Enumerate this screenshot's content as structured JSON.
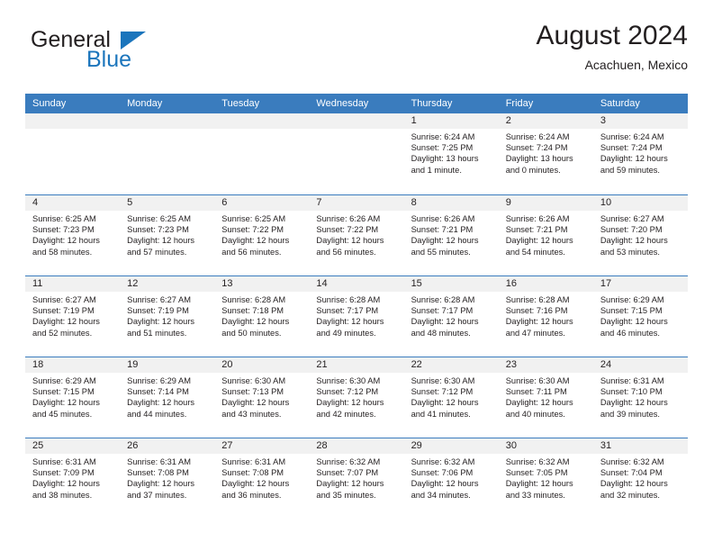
{
  "brand": {
    "name_top": "General",
    "name_bottom": "Blue",
    "accent_color": "#1b75bc"
  },
  "header": {
    "title": "August 2024",
    "subtitle": "Acachuen, Mexico"
  },
  "colors": {
    "header_row": "#3a7cbe",
    "day_band": "#f1f1f1",
    "text": "#231f20",
    "brand_blue": "#1b75bc"
  },
  "weekdays": [
    "Sunday",
    "Monday",
    "Tuesday",
    "Wednesday",
    "Thursday",
    "Friday",
    "Saturday"
  ],
  "weeks": [
    [
      {
        "day": "",
        "empty": true,
        "sunrise": "",
        "sunset": "",
        "daylight1": "",
        "daylight2": ""
      },
      {
        "day": "",
        "empty": true,
        "sunrise": "",
        "sunset": "",
        "daylight1": "",
        "daylight2": ""
      },
      {
        "day": "",
        "empty": true,
        "sunrise": "",
        "sunset": "",
        "daylight1": "",
        "daylight2": ""
      },
      {
        "day": "",
        "empty": true,
        "sunrise": "",
        "sunset": "",
        "daylight1": "",
        "daylight2": ""
      },
      {
        "day": "1",
        "empty": false,
        "sunrise": "Sunrise: 6:24 AM",
        "sunset": "Sunset: 7:25 PM",
        "daylight1": "Daylight: 13 hours",
        "daylight2": "and 1 minute."
      },
      {
        "day": "2",
        "empty": false,
        "sunrise": "Sunrise: 6:24 AM",
        "sunset": "Sunset: 7:24 PM",
        "daylight1": "Daylight: 13 hours",
        "daylight2": "and 0 minutes."
      },
      {
        "day": "3",
        "empty": false,
        "sunrise": "Sunrise: 6:24 AM",
        "sunset": "Sunset: 7:24 PM",
        "daylight1": "Daylight: 12 hours",
        "daylight2": "and 59 minutes."
      }
    ],
    [
      {
        "day": "4",
        "empty": false,
        "sunrise": "Sunrise: 6:25 AM",
        "sunset": "Sunset: 7:23 PM",
        "daylight1": "Daylight: 12 hours",
        "daylight2": "and 58 minutes."
      },
      {
        "day": "5",
        "empty": false,
        "sunrise": "Sunrise: 6:25 AM",
        "sunset": "Sunset: 7:23 PM",
        "daylight1": "Daylight: 12 hours",
        "daylight2": "and 57 minutes."
      },
      {
        "day": "6",
        "empty": false,
        "sunrise": "Sunrise: 6:25 AM",
        "sunset": "Sunset: 7:22 PM",
        "daylight1": "Daylight: 12 hours",
        "daylight2": "and 56 minutes."
      },
      {
        "day": "7",
        "empty": false,
        "sunrise": "Sunrise: 6:26 AM",
        "sunset": "Sunset: 7:22 PM",
        "daylight1": "Daylight: 12 hours",
        "daylight2": "and 56 minutes."
      },
      {
        "day": "8",
        "empty": false,
        "sunrise": "Sunrise: 6:26 AM",
        "sunset": "Sunset: 7:21 PM",
        "daylight1": "Daylight: 12 hours",
        "daylight2": "and 55 minutes."
      },
      {
        "day": "9",
        "empty": false,
        "sunrise": "Sunrise: 6:26 AM",
        "sunset": "Sunset: 7:21 PM",
        "daylight1": "Daylight: 12 hours",
        "daylight2": "and 54 minutes."
      },
      {
        "day": "10",
        "empty": false,
        "sunrise": "Sunrise: 6:27 AM",
        "sunset": "Sunset: 7:20 PM",
        "daylight1": "Daylight: 12 hours",
        "daylight2": "and 53 minutes."
      }
    ],
    [
      {
        "day": "11",
        "empty": false,
        "sunrise": "Sunrise: 6:27 AM",
        "sunset": "Sunset: 7:19 PM",
        "daylight1": "Daylight: 12 hours",
        "daylight2": "and 52 minutes."
      },
      {
        "day": "12",
        "empty": false,
        "sunrise": "Sunrise: 6:27 AM",
        "sunset": "Sunset: 7:19 PM",
        "daylight1": "Daylight: 12 hours",
        "daylight2": "and 51 minutes."
      },
      {
        "day": "13",
        "empty": false,
        "sunrise": "Sunrise: 6:28 AM",
        "sunset": "Sunset: 7:18 PM",
        "daylight1": "Daylight: 12 hours",
        "daylight2": "and 50 minutes."
      },
      {
        "day": "14",
        "empty": false,
        "sunrise": "Sunrise: 6:28 AM",
        "sunset": "Sunset: 7:17 PM",
        "daylight1": "Daylight: 12 hours",
        "daylight2": "and 49 minutes."
      },
      {
        "day": "15",
        "empty": false,
        "sunrise": "Sunrise: 6:28 AM",
        "sunset": "Sunset: 7:17 PM",
        "daylight1": "Daylight: 12 hours",
        "daylight2": "and 48 minutes."
      },
      {
        "day": "16",
        "empty": false,
        "sunrise": "Sunrise: 6:28 AM",
        "sunset": "Sunset: 7:16 PM",
        "daylight1": "Daylight: 12 hours",
        "daylight2": "and 47 minutes."
      },
      {
        "day": "17",
        "empty": false,
        "sunrise": "Sunrise: 6:29 AM",
        "sunset": "Sunset: 7:15 PM",
        "daylight1": "Daylight: 12 hours",
        "daylight2": "and 46 minutes."
      }
    ],
    [
      {
        "day": "18",
        "empty": false,
        "sunrise": "Sunrise: 6:29 AM",
        "sunset": "Sunset: 7:15 PM",
        "daylight1": "Daylight: 12 hours",
        "daylight2": "and 45 minutes."
      },
      {
        "day": "19",
        "empty": false,
        "sunrise": "Sunrise: 6:29 AM",
        "sunset": "Sunset: 7:14 PM",
        "daylight1": "Daylight: 12 hours",
        "daylight2": "and 44 minutes."
      },
      {
        "day": "20",
        "empty": false,
        "sunrise": "Sunrise: 6:30 AM",
        "sunset": "Sunset: 7:13 PM",
        "daylight1": "Daylight: 12 hours",
        "daylight2": "and 43 minutes."
      },
      {
        "day": "21",
        "empty": false,
        "sunrise": "Sunrise: 6:30 AM",
        "sunset": "Sunset: 7:12 PM",
        "daylight1": "Daylight: 12 hours",
        "daylight2": "and 42 minutes."
      },
      {
        "day": "22",
        "empty": false,
        "sunrise": "Sunrise: 6:30 AM",
        "sunset": "Sunset: 7:12 PM",
        "daylight1": "Daylight: 12 hours",
        "daylight2": "and 41 minutes."
      },
      {
        "day": "23",
        "empty": false,
        "sunrise": "Sunrise: 6:30 AM",
        "sunset": "Sunset: 7:11 PM",
        "daylight1": "Daylight: 12 hours",
        "daylight2": "and 40 minutes."
      },
      {
        "day": "24",
        "empty": false,
        "sunrise": "Sunrise: 6:31 AM",
        "sunset": "Sunset: 7:10 PM",
        "daylight1": "Daylight: 12 hours",
        "daylight2": "and 39 minutes."
      }
    ],
    [
      {
        "day": "25",
        "empty": false,
        "sunrise": "Sunrise: 6:31 AM",
        "sunset": "Sunset: 7:09 PM",
        "daylight1": "Daylight: 12 hours",
        "daylight2": "and 38 minutes."
      },
      {
        "day": "26",
        "empty": false,
        "sunrise": "Sunrise: 6:31 AM",
        "sunset": "Sunset: 7:08 PM",
        "daylight1": "Daylight: 12 hours",
        "daylight2": "and 37 minutes."
      },
      {
        "day": "27",
        "empty": false,
        "sunrise": "Sunrise: 6:31 AM",
        "sunset": "Sunset: 7:08 PM",
        "daylight1": "Daylight: 12 hours",
        "daylight2": "and 36 minutes."
      },
      {
        "day": "28",
        "empty": false,
        "sunrise": "Sunrise: 6:32 AM",
        "sunset": "Sunset: 7:07 PM",
        "daylight1": "Daylight: 12 hours",
        "daylight2": "and 35 minutes."
      },
      {
        "day": "29",
        "empty": false,
        "sunrise": "Sunrise: 6:32 AM",
        "sunset": "Sunset: 7:06 PM",
        "daylight1": "Daylight: 12 hours",
        "daylight2": "and 34 minutes."
      },
      {
        "day": "30",
        "empty": false,
        "sunrise": "Sunrise: 6:32 AM",
        "sunset": "Sunset: 7:05 PM",
        "daylight1": "Daylight: 12 hours",
        "daylight2": "and 33 minutes."
      },
      {
        "day": "31",
        "empty": false,
        "sunrise": "Sunrise: 6:32 AM",
        "sunset": "Sunset: 7:04 PM",
        "daylight1": "Daylight: 12 hours",
        "daylight2": "and 32 minutes."
      }
    ]
  ]
}
